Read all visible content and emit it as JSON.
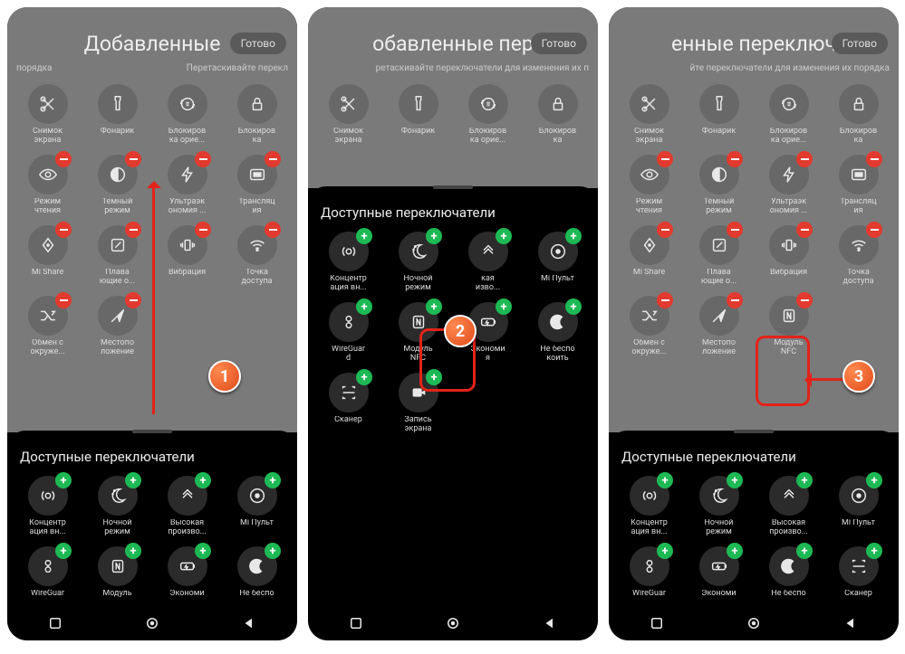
{
  "done_label": "Готово",
  "available_title": "Доступные переключатели",
  "panels": [
    {
      "title": "Добавленные",
      "sub_left": "порядка",
      "sub_right": "Перетаскивайте перекл",
      "gray_class": "tall",
      "step": "1",
      "step_style": "top:390px; left:222px;",
      "arrow_up_style": "top:200px; left:160px; height:250px;",
      "added": [
        {
          "icon": "scissors",
          "label": "Снимок\nэкрана",
          "badge": ""
        },
        {
          "icon": "flashlight",
          "label": "Фонарик",
          "badge": ""
        },
        {
          "icon": "lockorient",
          "label": "Блокиров\nка орие...",
          "badge": ""
        },
        {
          "icon": "lock",
          "label": "Блокиров\nка",
          "badge": ""
        },
        {
          "icon": "eye",
          "label": "Режим\nчтения",
          "badge": "minus"
        },
        {
          "icon": "darkmode",
          "label": "Темный\nрежим",
          "badge": "minus"
        },
        {
          "icon": "bolt",
          "label": "Ультраэк\nономия ...",
          "badge": "minus"
        },
        {
          "icon": "cast",
          "label": "Трансляц\nия",
          "badge": "minus"
        },
        {
          "icon": "mishare",
          "label": "Mi Share",
          "badge": "minus"
        },
        {
          "icon": "float",
          "label": "Плава\nющие о...",
          "badge": "minus"
        },
        {
          "icon": "vibration",
          "label": "Вибрация",
          "badge": "minus"
        },
        {
          "icon": "wifi",
          "label": "Точка\nдоступа",
          "badge": "minus"
        },
        {
          "icon": "shuffle",
          "label": "Обмен с\nокруже...",
          "badge": "minus"
        },
        {
          "icon": "location",
          "label": "Местопо\nложение",
          "badge": "minus"
        }
      ],
      "available": [
        {
          "icon": "concentration",
          "label": "Концентр\nация вн...",
          "badge": "plus"
        },
        {
          "icon": "nightmode",
          "label": "Ночной\nрежим",
          "badge": "plus"
        },
        {
          "icon": "highperf",
          "label": "Высокая\nпроизво...",
          "badge": "plus"
        },
        {
          "icon": "remote",
          "label": "Mi Пульт",
          "badge": "plus"
        },
        {
          "icon": "wireguard",
          "label": "WireGuar",
          "badge": "plus"
        },
        {
          "icon": "nfc",
          "label": "Модуль",
          "badge": "plus"
        },
        {
          "icon": "battery",
          "label": "Экономи",
          "badge": "plus"
        },
        {
          "icon": "dnd",
          "label": "Не беспо",
          "badge": "plus"
        }
      ]
    },
    {
      "title": "обавленные пер",
      "sub_left": "",
      "sub_right": "ретаскивайте переключатели для изменения их п",
      "gray_class": "short",
      "step": "2",
      "step_style": "top:340px; left:150px;",
      "redbox_style": "top:355px; left:123px; width:62px; height:70px;",
      "added": [
        {
          "icon": "scissors",
          "label": "Снимок\nэкрана",
          "badge": ""
        },
        {
          "icon": "flashlight",
          "label": "Фонарик",
          "badge": ""
        },
        {
          "icon": "lockorient",
          "label": "Блокиров\nка орие...",
          "badge": ""
        },
        {
          "icon": "lock",
          "label": "Блокиров\nка",
          "badge": ""
        }
      ],
      "available": [
        {
          "icon": "concentration",
          "label": "Концентр\nация вн...",
          "badge": "plus"
        },
        {
          "icon": "nightmode",
          "label": "Ночной\nрежим",
          "badge": "plus"
        },
        {
          "icon": "highperf",
          "label": "кая\nизво...",
          "badge": "plus"
        },
        {
          "icon": "remote",
          "label": "Mi Пульт",
          "badge": "plus"
        },
        {
          "icon": "wireguard",
          "label": "WireGuar\nd",
          "badge": "plus"
        },
        {
          "icon": "nfc",
          "label": "Модуль\nNFC",
          "badge": "plus"
        },
        {
          "icon": "battery",
          "label": "Экономи\nя",
          "badge": "plus"
        },
        {
          "icon": "dnd",
          "label": "Не беспо\nкоить",
          "badge": "plus"
        },
        {
          "icon": "scanner",
          "label": "Сканер",
          "badge": "plus"
        },
        {
          "icon": "record",
          "label": "Запись\nэкрана",
          "badge": "plus"
        }
      ]
    },
    {
      "title": "енные переключ",
      "sub_left": "",
      "sub_right": "йте переключатели для изменения их порядка",
      "gray_class": "tall",
      "step": "3",
      "step_style": "top:390px; left:258px;",
      "arrow_left_style": "top:410px; left:224px; width:40px;",
      "redbox_style": "top:363px; left:162px; width:60px; height:78px;",
      "added": [
        {
          "icon": "scissors",
          "label": "Снимок\nэкрана",
          "badge": ""
        },
        {
          "icon": "flashlight",
          "label": "Фонарик",
          "badge": ""
        },
        {
          "icon": "lockorient",
          "label": "Блокиров\nка орие...",
          "badge": ""
        },
        {
          "icon": "lock",
          "label": "Блокиров\nка",
          "badge": ""
        },
        {
          "icon": "eye",
          "label": "Режим\nчтения",
          "badge": "minus"
        },
        {
          "icon": "darkmode",
          "label": "Темный\nрежим",
          "badge": "minus"
        },
        {
          "icon": "bolt",
          "label": "Ультраэк\nономия ...",
          "badge": "minus"
        },
        {
          "icon": "cast",
          "label": "Трансляц\nия",
          "badge": "minus"
        },
        {
          "icon": "mishare",
          "label": "Mi Share",
          "badge": "minus"
        },
        {
          "icon": "float",
          "label": "Плава\nющие о...",
          "badge": "minus"
        },
        {
          "icon": "vibration",
          "label": "Вибрация",
          "badge": "minus"
        },
        {
          "icon": "wifi",
          "label": "Точка\nдоступа",
          "badge": "minus"
        },
        {
          "icon": "shuffle",
          "label": "Обмен с\nокруже...",
          "badge": "minus"
        },
        {
          "icon": "location",
          "label": "Местопо\nложение",
          "badge": "minus"
        },
        {
          "icon": "nfc",
          "label": "Модуль\nNFC",
          "badge": "minus"
        }
      ],
      "available": [
        {
          "icon": "concentration",
          "label": "Концентр\nация вн...",
          "badge": "plus"
        },
        {
          "icon": "nightmode",
          "label": "Ночной\nрежим",
          "badge": "plus"
        },
        {
          "icon": "highperf",
          "label": "Высокая\nпроизво...",
          "badge": "plus"
        },
        {
          "icon": "remote",
          "label": "Mi Пульт",
          "badge": "plus"
        },
        {
          "icon": "wireguard",
          "label": "WireGuar",
          "badge": "plus"
        },
        {
          "icon": "battery",
          "label": "Экономи",
          "badge": "plus"
        },
        {
          "icon": "dnd",
          "label": "Не беспо",
          "badge": "plus"
        },
        {
          "icon": "scanner",
          "label": "Сканер",
          "badge": "plus"
        }
      ]
    }
  ]
}
